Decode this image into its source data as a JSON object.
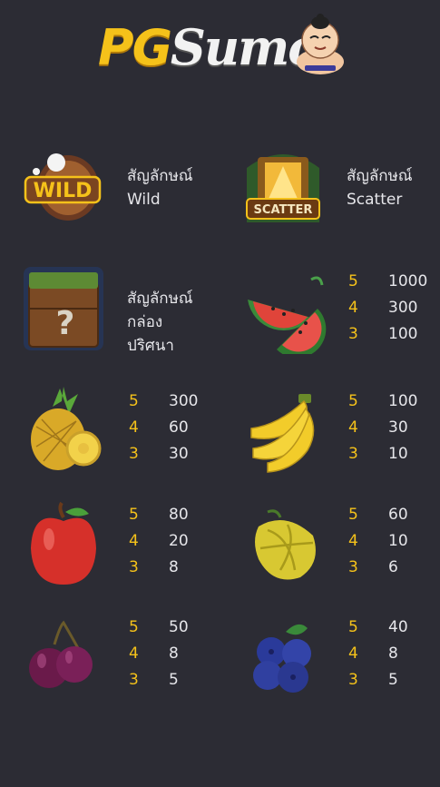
{
  "header": {
    "logo_brand": "PG",
    "logo_name": "Sumo"
  },
  "symbols": [
    {
      "name": "wild",
      "icon": "wild-icon",
      "label_line1": "สัญลักษณ์",
      "label_line2": "Wild"
    },
    {
      "name": "scatter",
      "icon": "scatter-icon",
      "label_line1": "สัญลักษณ์",
      "label_line2": "Scatter"
    },
    {
      "name": "mystery-box",
      "icon": "mystery-box-icon",
      "label_line1": "สัญลักษณ์",
      "label_line2": "กล่องปริศนา"
    },
    {
      "name": "watermelon",
      "icon": "watermelon-icon",
      "pays": [
        {
          "count": "5",
          "value": "1000"
        },
        {
          "count": "4",
          "value": "300"
        },
        {
          "count": "3",
          "value": "100"
        }
      ]
    },
    {
      "name": "pineapple",
      "icon": "pineapple-icon",
      "pays": [
        {
          "count": "5",
          "value": "300"
        },
        {
          "count": "4",
          "value": "60"
        },
        {
          "count": "3",
          "value": "30"
        }
      ]
    },
    {
      "name": "banana",
      "icon": "banana-icon",
      "pays": [
        {
          "count": "5",
          "value": "100"
        },
        {
          "count": "4",
          "value": "30"
        },
        {
          "count": "3",
          "value": "10"
        }
      ]
    },
    {
      "name": "apple",
      "icon": "apple-icon",
      "pays": [
        {
          "count": "5",
          "value": "80"
        },
        {
          "count": "4",
          "value": "20"
        },
        {
          "count": "3",
          "value": "8"
        }
      ]
    },
    {
      "name": "starfruit",
      "icon": "starfruit-icon",
      "pays": [
        {
          "count": "5",
          "value": "60"
        },
        {
          "count": "4",
          "value": "10"
        },
        {
          "count": "3",
          "value": "6"
        }
      ]
    },
    {
      "name": "plum",
      "icon": "plum-icon",
      "pays": [
        {
          "count": "5",
          "value": "50"
        },
        {
          "count": "4",
          "value": "8"
        },
        {
          "count": "3",
          "value": "5"
        }
      ]
    },
    {
      "name": "blueberry",
      "icon": "blueberry-icon",
      "pays": [
        {
          "count": "5",
          "value": "40"
        },
        {
          "count": "4",
          "value": "8"
        },
        {
          "count": "3",
          "value": "5"
        }
      ]
    }
  ],
  "colors": {
    "background": "#2c2c34",
    "count": "#f5c21a",
    "value": "#e6e6ea"
  }
}
